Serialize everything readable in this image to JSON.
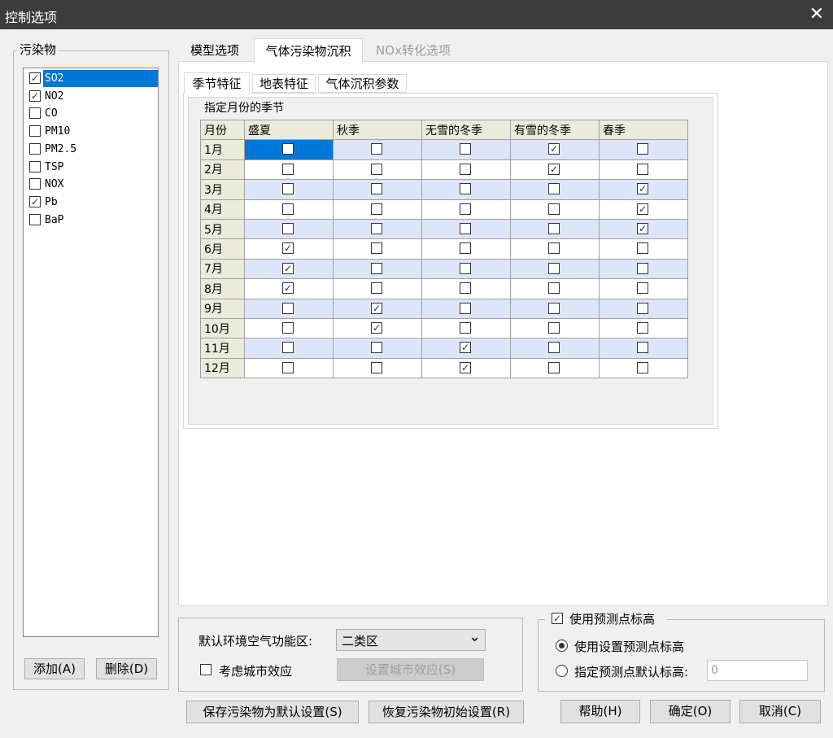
{
  "window": {
    "title": "控制选项",
    "close_glyph": "✕"
  },
  "pollutants": {
    "legend": "污染物",
    "items": [
      {
        "label": "SO2",
        "checked": true,
        "selected": true
      },
      {
        "label": "NO2",
        "checked": true,
        "selected": false
      },
      {
        "label": "CO",
        "checked": false,
        "selected": false
      },
      {
        "label": "PM10",
        "checked": false,
        "selected": false
      },
      {
        "label": "PM2.5",
        "checked": false,
        "selected": false
      },
      {
        "label": "TSP",
        "checked": false,
        "selected": false
      },
      {
        "label": "NOX",
        "checked": false,
        "selected": false
      },
      {
        "label": "Pb",
        "checked": true,
        "selected": false
      },
      {
        "label": "BaP",
        "checked": false,
        "selected": false
      }
    ],
    "add_button": "添加(A)",
    "delete_button": "删除(D)"
  },
  "main_tabs": [
    {
      "label": "模型选项",
      "state": "normal"
    },
    {
      "label": "气体污染物沉积",
      "state": "active"
    },
    {
      "label": "NOx转化选项",
      "state": "disabled"
    }
  ],
  "sub_tabs": [
    {
      "label": "季节特征",
      "state": "active"
    },
    {
      "label": "地表特征",
      "state": "normal"
    },
    {
      "label": "气体沉积参数",
      "state": "normal"
    }
  ],
  "season_table": {
    "caption": "指定月份的季节",
    "month_header": "月份",
    "columns": [
      "盛夏",
      "秋季",
      "无雪的冬季",
      "有雪的冬季",
      "春季"
    ],
    "rows": [
      {
        "month": "1月",
        "checks": [
          false,
          false,
          false,
          true,
          false
        ]
      },
      {
        "month": "2月",
        "checks": [
          false,
          false,
          false,
          true,
          false
        ]
      },
      {
        "month": "3月",
        "checks": [
          false,
          false,
          false,
          false,
          true
        ]
      },
      {
        "month": "4月",
        "checks": [
          false,
          false,
          false,
          false,
          true
        ]
      },
      {
        "month": "5月",
        "checks": [
          false,
          false,
          false,
          false,
          true
        ]
      },
      {
        "month": "6月",
        "checks": [
          true,
          false,
          false,
          false,
          false
        ]
      },
      {
        "month": "7月",
        "checks": [
          true,
          false,
          false,
          false,
          false
        ]
      },
      {
        "month": "8月",
        "checks": [
          true,
          false,
          false,
          false,
          false
        ]
      },
      {
        "month": "9月",
        "checks": [
          false,
          true,
          false,
          false,
          false
        ]
      },
      {
        "month": "10月",
        "checks": [
          false,
          true,
          false,
          false,
          false
        ]
      },
      {
        "month": "11月",
        "checks": [
          false,
          false,
          true,
          false,
          false
        ]
      },
      {
        "month": "12月",
        "checks": [
          false,
          false,
          true,
          false,
          false
        ]
      }
    ]
  },
  "env_zone": {
    "label": "默认环境空气功能区:",
    "value": "二类区",
    "urban_effect_label": "考虑城市效应",
    "urban_effect_checked": false,
    "set_urban_button": "设置城市效应(S)"
  },
  "elevation": {
    "legend_label": "使用预测点标高",
    "legend_checked": true,
    "option_use_set": "使用设置预测点标高",
    "option_use_set_selected": true,
    "option_default": "指定预测点默认标高:",
    "option_default_selected": false,
    "default_value": "0"
  },
  "footer": {
    "save_default": "保存污染物为默认设置(S)",
    "restore_default": "恢复污染物初始设置(R)",
    "help": "帮助(H)",
    "ok": "确定(O)",
    "cancel": "取消(C)"
  },
  "glyphs": {
    "check": "✓",
    "dropdown": "⌄"
  },
  "colors": {
    "selection": "#0078d7",
    "row_alt": "#dde6f8",
    "header": "#ebebdc",
    "titlebar": "#3c3c3c"
  }
}
